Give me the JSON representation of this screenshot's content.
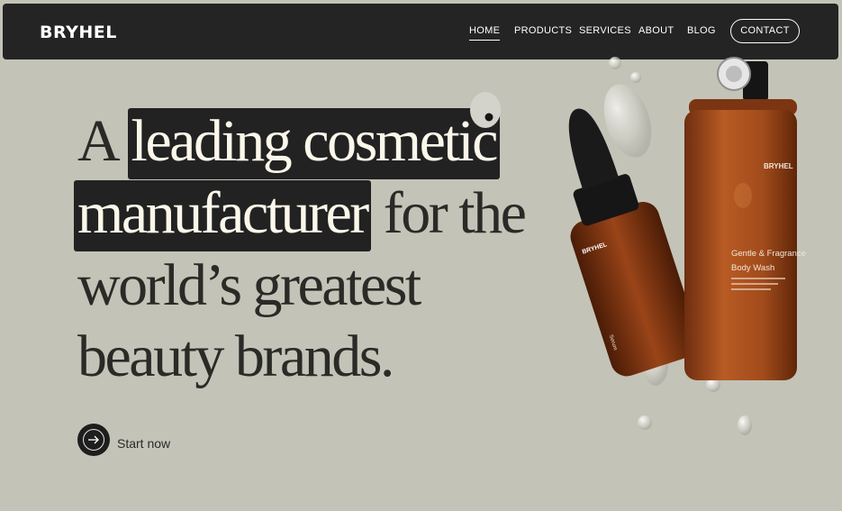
{
  "brand": {
    "logo_text": "BRYHEL"
  },
  "nav": {
    "items": [
      {
        "label": "HOME",
        "active": true
      },
      {
        "label": "PRODUCTS",
        "active": false
      },
      {
        "label": "SERVICES",
        "active": false
      },
      {
        "label": "ABOUT",
        "active": false
      },
      {
        "label": "BLOG",
        "active": false
      }
    ],
    "contact_label": "CONTACT"
  },
  "hero": {
    "line1_prefix": "A",
    "line1_highlight": "leading cosmetic",
    "line2_highlight": "manufacturer",
    "line2_suffix": "for the",
    "line3": "world’s greatest",
    "line4": "beauty brands.",
    "cta_label": "Start now"
  },
  "product_image": {
    "big_bottle": {
      "brand": "BRYHEL",
      "title_line1": "Gentle & Fragrance",
      "title_line2": "Body Wash"
    },
    "small_bottle": {
      "brand": "BRYHEL",
      "label": "Serum"
    }
  },
  "colors": {
    "background": "#c4c3b8",
    "navbar": "#242424",
    "highlight": "#222222",
    "amber": "#a8511f"
  }
}
